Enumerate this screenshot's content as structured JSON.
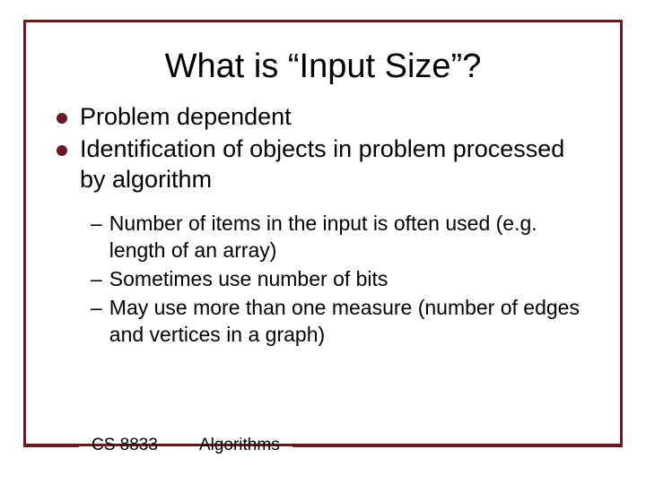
{
  "title": "What is “Input Size”?",
  "bullets": [
    {
      "text": "Problem dependent"
    },
    {
      "text": "Identification of objects in problem processed by algorithm"
    }
  ],
  "subbullets": [
    {
      "text": "Number of items in the input is often used (e.g. length of an array)"
    },
    {
      "text": "Sometimes use number of bits"
    },
    {
      "text": "May use more than one measure (number of edges and vertices in a graph)"
    }
  ],
  "footer": {
    "course": "CS 8833",
    "topic": "Algorithms"
  },
  "colors": {
    "accent": "#6b1820"
  }
}
